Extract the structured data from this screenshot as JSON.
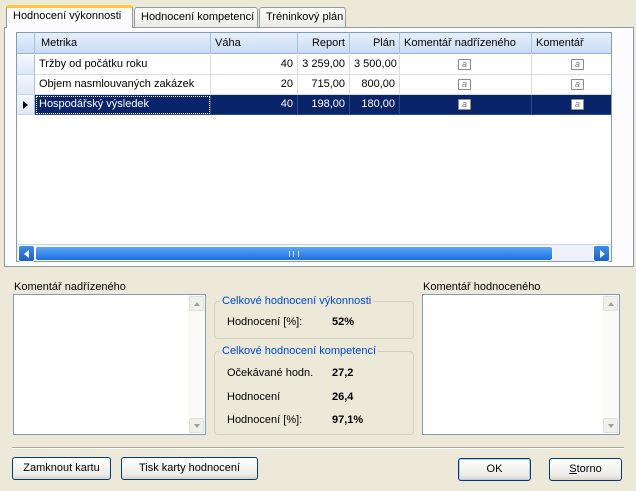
{
  "tabs": [
    {
      "label": "Hodnocení výkonnosti",
      "active": true
    },
    {
      "label": "Hodnocení kompetencí",
      "active": false
    },
    {
      "label": "Tréninkový plán",
      "active": false
    }
  ],
  "grid": {
    "columns": [
      "Metrika",
      "Váha",
      "Report",
      "Plán",
      "Komentář nadřízeného",
      "Komentář"
    ],
    "rows": [
      {
        "metric": "Tržby od počátku roku",
        "weight": "40",
        "report": "3 259,00",
        "plan": "3 500,00",
        "selected": false
      },
      {
        "metric": "Objem nasmlouvaných zakázek",
        "weight": "20",
        "report": "715,00",
        "plan": "800,00",
        "selected": false
      },
      {
        "metric": "Hospodářský výsledek",
        "weight": "40",
        "report": "198,00",
        "plan": "180,00",
        "selected": true
      }
    ],
    "memo_glyph": "a",
    "scroll_grip": "III"
  },
  "supervisor_comment": {
    "label": "Komentář nadřízeného",
    "value": ""
  },
  "employee_comment": {
    "label": "Komentář hodnoceného",
    "value": ""
  },
  "performance_summary": {
    "title": "Celkové hodnocení výkonnosti",
    "rating_label": "Hodnocení [%]:",
    "rating_value": "52%"
  },
  "competence_summary": {
    "title": "Celkové hodnocení kompetencí",
    "expected_label": "Očekávané hodn.",
    "expected_value": "27,2",
    "rating_label": "Hodnocení",
    "rating_value": "26,4",
    "rating_pct_label": "Hodnocení [%]:",
    "rating_pct_value": "97,1%"
  },
  "buttons": {
    "lock": "Zamknout kartu",
    "print": "Tisk karty hodnocení",
    "ok": "OK",
    "cancel_prefix": "S",
    "cancel_rest": "torno"
  },
  "colors": {
    "selection": "#0a246a",
    "active_tab_accent": "#ffc83c",
    "group_title": "#0046d5",
    "scroll_blue": "#1f6ee0"
  }
}
